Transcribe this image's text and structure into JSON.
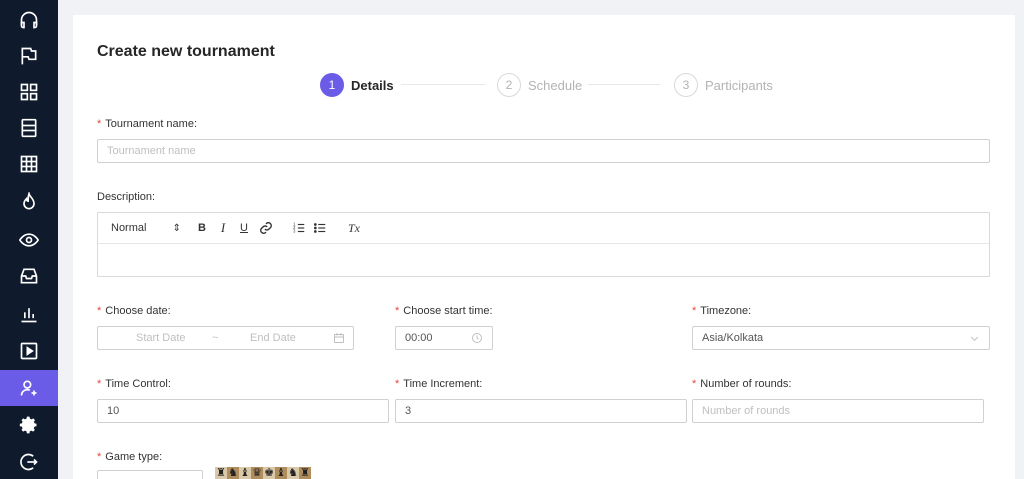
{
  "sidebar": {
    "items": [
      {
        "name": "headphones-icon",
        "active": false
      },
      {
        "name": "flag-icon",
        "active": false
      },
      {
        "name": "grid-icon",
        "active": false
      },
      {
        "name": "server-icon",
        "active": false
      },
      {
        "name": "table-icon",
        "active": false
      },
      {
        "name": "flame-icon",
        "active": false
      },
      {
        "name": "eye-icon",
        "active": false
      },
      {
        "name": "inbox-icon",
        "active": false
      },
      {
        "name": "bar-chart-icon",
        "active": false
      },
      {
        "name": "play-icon",
        "active": false
      },
      {
        "name": "user-plus-icon",
        "active": true
      },
      {
        "name": "gear-icon",
        "active": false
      },
      {
        "name": "logout-icon",
        "active": false
      }
    ],
    "active_color": "#6b5ce7",
    "background": "#0f1b2d"
  },
  "page": {
    "title": "Create new tournament"
  },
  "steps": [
    {
      "number": "1",
      "label": "Details",
      "active": true
    },
    {
      "number": "2",
      "label": "Schedule",
      "active": false
    },
    {
      "number": "3",
      "label": "Participants",
      "active": false
    }
  ],
  "form": {
    "tournament_name": {
      "label": "Tournament name",
      "placeholder": "Tournament name",
      "value": ""
    },
    "description": {
      "label": "Description",
      "toolbar": {
        "header_select": "Normal",
        "header_arrow": "⇕",
        "bold": "B",
        "italic": "I",
        "underline": "U",
        "clear": "Tx"
      }
    },
    "choose_date": {
      "label": "Choose date",
      "start_placeholder": "Start Date",
      "separator": "~",
      "end_placeholder": "End Date"
    },
    "choose_start_time": {
      "label": "Choose start time",
      "value": "00:00"
    },
    "timezone": {
      "label": "Timezone",
      "value": "Asia/Kolkata"
    },
    "time_control": {
      "label": "Time Control",
      "value": "10"
    },
    "time_increment": {
      "label": "Time Increment",
      "value": "3"
    },
    "number_of_rounds": {
      "label": "Number of rounds",
      "placeholder": "Number of rounds",
      "value": ""
    },
    "game_type": {
      "label": "Game type",
      "pieces": [
        "♜",
        "♞",
        "♝",
        "♛",
        "♚",
        "♝",
        "♞",
        "♜"
      ]
    }
  },
  "colors": {
    "required": "#e8453c",
    "accent": "#6b5ce7"
  }
}
